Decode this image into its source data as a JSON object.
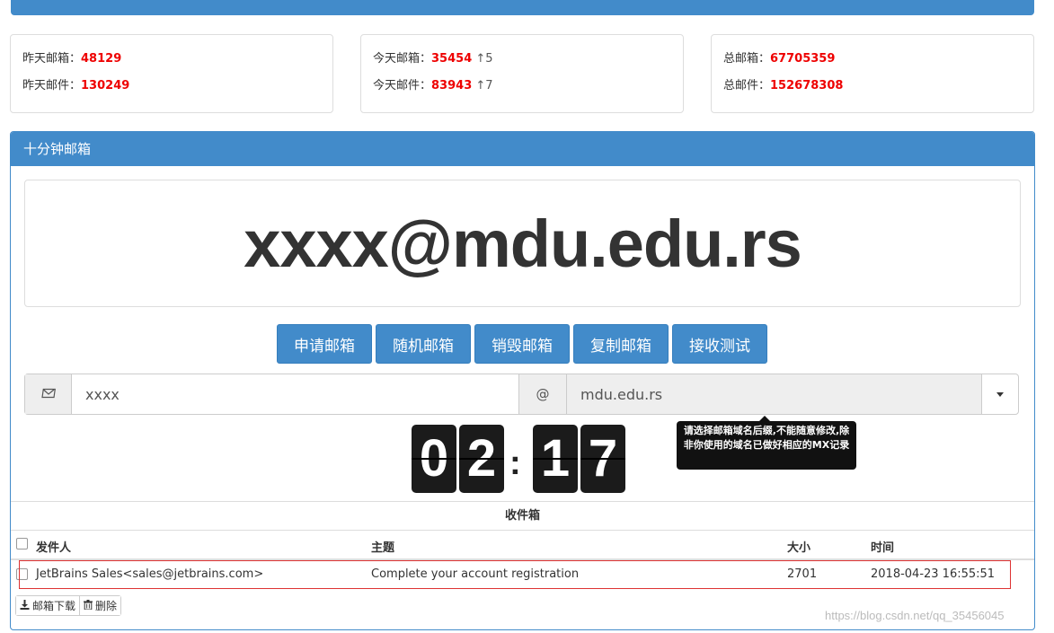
{
  "stats": {
    "yesterday": {
      "boxes_label": "昨天邮箱：",
      "boxes_value": "48129",
      "mails_label": "昨天邮件：",
      "mails_value": "130249"
    },
    "today": {
      "boxes_label": "今天邮箱：",
      "boxes_value": "35454",
      "boxes_delta": "↑5",
      "mails_label": "今天邮件：",
      "mails_value": "83943",
      "mails_delta": "↑7"
    },
    "total": {
      "boxes_label": "总邮箱：",
      "boxes_value": "67705359",
      "mails_label": "总邮件：",
      "mails_value": "152678308"
    }
  },
  "panel": {
    "title": "十分钟邮箱",
    "email_display": "xxxx@mdu.edu.rs"
  },
  "buttons": [
    "申请邮箱",
    "随机邮箱",
    "销毁邮箱",
    "复制邮箱",
    "接收测试"
  ],
  "form": {
    "envelope_icon": "envelope-icon",
    "username_value": "xxxx",
    "at_symbol": "@",
    "domain_value": "mdu.edu.rs"
  },
  "tooltip": "请选择邮箱域名后缀,不能随意修改,除非你使用的域名已做好相应的MX记录",
  "timer": {
    "d1": "0",
    "d2": "2",
    "d3": "1",
    "d4": "7",
    "separator": ":"
  },
  "inbox": {
    "title": "收件箱",
    "columns": {
      "sender": "发件人",
      "subject": "主题",
      "size": "大小",
      "time": "时间"
    },
    "rows": [
      {
        "sender": "JetBrains Sales<sales@jetbrains.com>",
        "subject": "Complete your account registration",
        "size": "2701",
        "time": "2018-04-23 16:55:51"
      }
    ],
    "download_label": "邮箱下载",
    "delete_label": "删除"
  },
  "watermark": "https://blog.csdn.net/qq_35456045"
}
